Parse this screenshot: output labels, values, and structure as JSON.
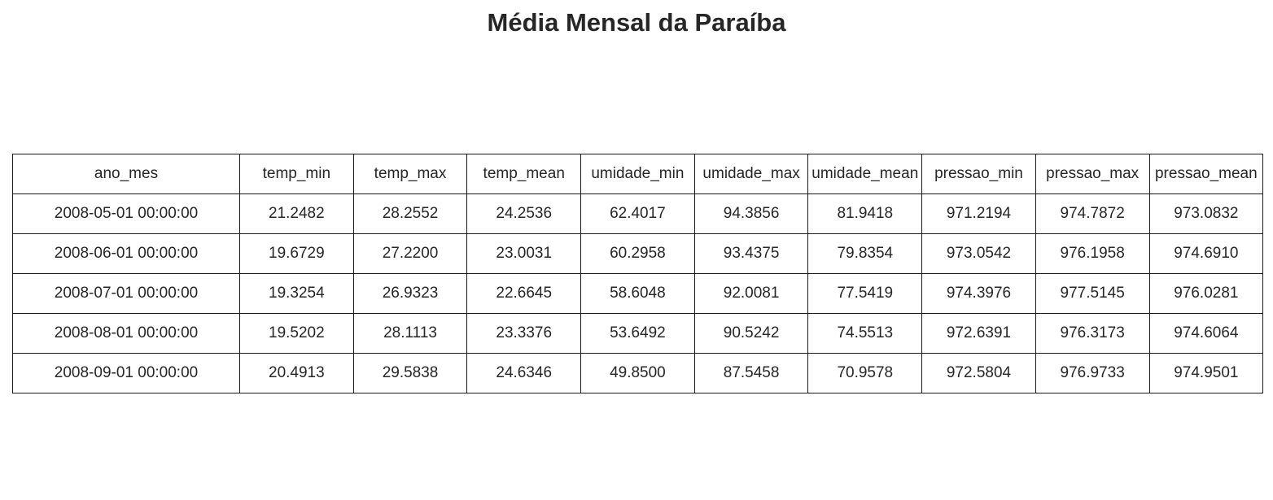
{
  "chart_data": {
    "type": "table",
    "title": "Média Mensal da Paraíba",
    "columns": [
      "ano_mes",
      "temp_min",
      "temp_max",
      "temp_mean",
      "umidade_min",
      "umidade_max",
      "umidade_mean",
      "pressao_min",
      "pressao_max",
      "pressao_mean"
    ],
    "rows": [
      [
        "2008-05-01 00:00:00",
        "21.2482",
        "28.2552",
        "24.2536",
        "62.4017",
        "94.3856",
        "81.9418",
        "971.2194",
        "974.7872",
        "973.0832"
      ],
      [
        "2008-06-01 00:00:00",
        "19.6729",
        "27.2200",
        "23.0031",
        "60.2958",
        "93.4375",
        "79.8354",
        "973.0542",
        "976.1958",
        "974.6910"
      ],
      [
        "2008-07-01 00:00:00",
        "19.3254",
        "26.9323",
        "22.6645",
        "58.6048",
        "92.0081",
        "77.5419",
        "974.3976",
        "977.5145",
        "976.0281"
      ],
      [
        "2008-08-01 00:00:00",
        "19.5202",
        "28.1113",
        "23.3376",
        "53.6492",
        "90.5242",
        "74.5513",
        "972.6391",
        "976.3173",
        "974.6064"
      ],
      [
        "2008-09-01 00:00:00",
        "20.4913",
        "29.5838",
        "24.6346",
        "49.8500",
        "87.5458",
        "70.9578",
        "972.5804",
        "976.9733",
        "974.9501"
      ]
    ]
  }
}
